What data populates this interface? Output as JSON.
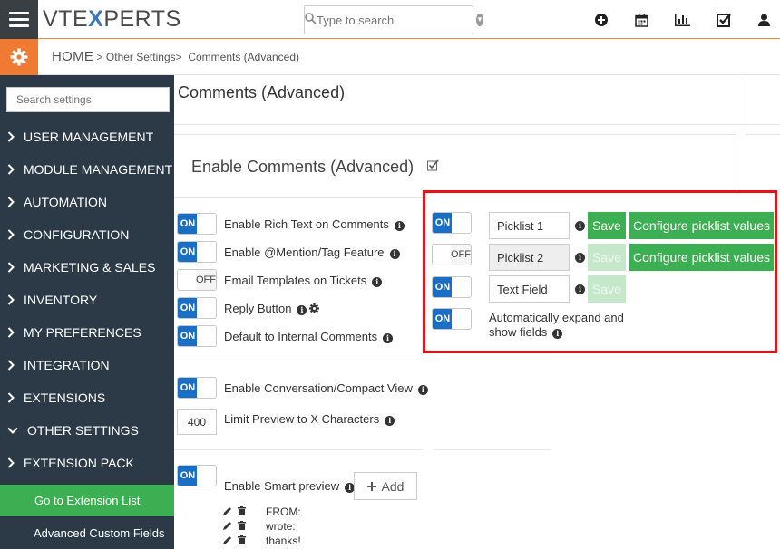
{
  "header": {
    "logo": {
      "part1": "VTE",
      "part2": "X",
      "part3": "PERTS"
    },
    "search_placeholder": "Type to search",
    "icons": [
      "plus-circle-icon",
      "calendar-icon",
      "bar-chart-icon",
      "checkbox-icon",
      "user-icon"
    ]
  },
  "breadcrumb": {
    "home": "HOME",
    "sep": ">",
    "level1": "Other Settings",
    "current": "Comments (Advanced)"
  },
  "sidebar": {
    "search_placeholder": "Search settings",
    "items": [
      {
        "label": "USER MANAGEMENT",
        "state": "collapsed"
      },
      {
        "label": "MODULE MANAGEMENT",
        "state": "collapsed"
      },
      {
        "label": "AUTOMATION",
        "state": "collapsed"
      },
      {
        "label": "CONFIGURATION",
        "state": "collapsed"
      },
      {
        "label": "MARKETING & SALES",
        "state": "collapsed"
      },
      {
        "label": "INVENTORY",
        "state": "collapsed"
      },
      {
        "label": "MY PREFERENCES",
        "state": "collapsed"
      },
      {
        "label": "INTEGRATION",
        "state": "collapsed"
      },
      {
        "label": "EXTENSIONS",
        "state": "collapsed"
      },
      {
        "label": "OTHER SETTINGS",
        "state": "expanded"
      },
      {
        "label": "EXTENSION PACK",
        "state": "collapsed"
      }
    ],
    "sub_items": [
      {
        "label": "Go to Extension List",
        "active": true
      },
      {
        "label": "Advanced Custom Fields",
        "active": false
      }
    ]
  },
  "main": {
    "page_title": "Comments (Advanced)",
    "section_title": "Enable Comments (Advanced)",
    "toggle_on": "ON",
    "toggle_off": "OFF",
    "options": [
      {
        "label": "Enable Rich Text on Comments",
        "state": "on"
      },
      {
        "label": "Enable @Mention/Tag Feature",
        "state": "on"
      },
      {
        "label": "Email Templates on Tickets",
        "state": "off"
      },
      {
        "label": "Reply Button",
        "state": "on"
      },
      {
        "label": "Default to Internal Comments",
        "state": "on"
      }
    ],
    "conversation_view": {
      "label": "Enable Conversation/Compact View",
      "state": "on"
    },
    "limit_preview": {
      "value": "400",
      "label": "Limit Preview to X Characters"
    },
    "smart_preview": {
      "label": "Enable Smart preview",
      "state": "on",
      "add_label": "Add",
      "words": [
        "FROM:",
        "wrote:",
        "thanks!"
      ]
    },
    "highlight_panel": {
      "rows": [
        {
          "state": "on",
          "value": "Picklist 1",
          "save": "Save",
          "configure": "Configure picklist values",
          "save_enabled": true
        },
        {
          "state": "off",
          "value": "Picklist 2",
          "save": "Save",
          "configure": "Configure picklist values",
          "save_enabled": false
        },
        {
          "state": "on",
          "value": "Text Field",
          "save": "Save",
          "save_enabled": false
        }
      ],
      "auto_expand": {
        "state": "on",
        "line1": "Automatically expand and",
        "line2": "show fields"
      }
    }
  },
  "colors": {
    "accent_orange": "#f07a32",
    "sidebar_bg": "#2c3a47",
    "toggle_blue": "#1a6fc4",
    "green": "#3caf52",
    "highlight_red": "#e3121b"
  }
}
